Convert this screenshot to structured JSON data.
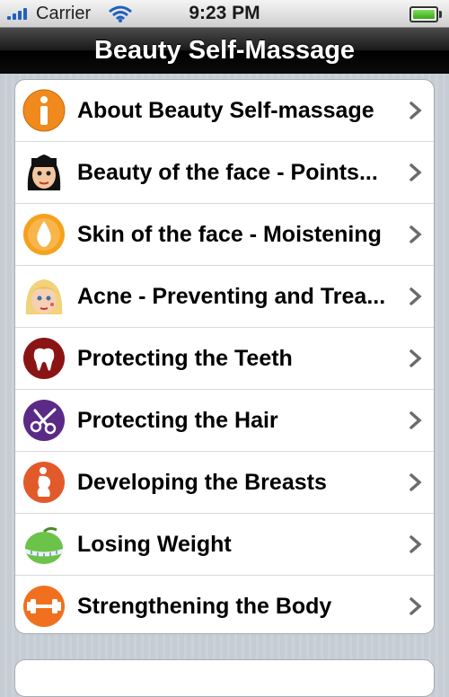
{
  "status_bar": {
    "carrier": "Carrier",
    "time": "9:23 PM"
  },
  "nav": {
    "title": "Beauty Self-Massage"
  },
  "menu": {
    "items": [
      {
        "label": "About Beauty Self-massage",
        "icon": "info-icon"
      },
      {
        "label": "Beauty of the face - Points...",
        "icon": "woman-face-icon"
      },
      {
        "label": "Skin of the face - Moistening",
        "icon": "water-drop-icon"
      },
      {
        "label": "Acne - Preventing and Trea...",
        "icon": "blonde-face-icon"
      },
      {
        "label": "Protecting the Teeth",
        "icon": "tooth-icon"
      },
      {
        "label": "Protecting the Hair",
        "icon": "scissors-icon"
      },
      {
        "label": "Developing the Breasts",
        "icon": "body-silhouette-icon"
      },
      {
        "label": "Losing Weight",
        "icon": "apple-measuring-tape-icon"
      },
      {
        "label": "Strengthening the Body",
        "icon": "dumbbell-icon"
      }
    ]
  },
  "colors": {
    "info": "#f08a1c",
    "drop": "#f5a11c",
    "tooth": "#8a1414",
    "scissors": "#5b2a87",
    "body": "#e35a2a",
    "apple": "#6cc34a",
    "dumbbell": "#f07020"
  }
}
